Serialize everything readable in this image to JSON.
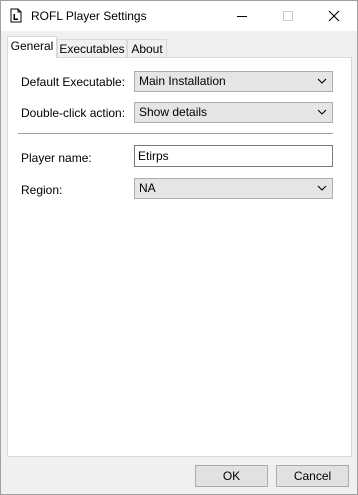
{
  "window": {
    "title": "ROFL Player Settings",
    "icon": "document-icon"
  },
  "tabs": [
    {
      "label": "General",
      "active": true
    },
    {
      "label": "Executables",
      "active": false
    },
    {
      "label": "About",
      "active": false
    }
  ],
  "general": {
    "default_executable": {
      "label": "Default Executable:",
      "value": "Main Installation"
    },
    "double_click_action": {
      "label": "Double-click action:",
      "value": "Show details"
    },
    "player_name": {
      "label": "Player name:",
      "value": "Etirps"
    },
    "region": {
      "label": "Region:",
      "value": "NA"
    }
  },
  "buttons": {
    "ok": "OK",
    "cancel": "Cancel"
  }
}
